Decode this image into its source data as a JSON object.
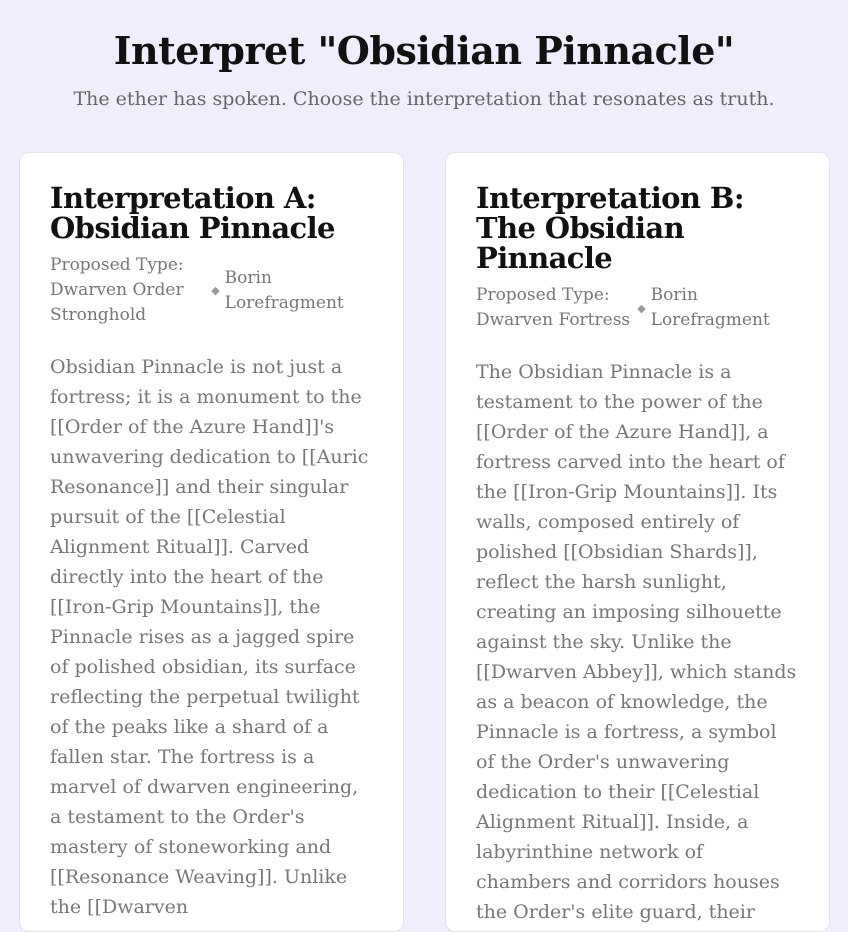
{
  "header": {
    "title": "Interpret \"Obsidian Pinnacle\"",
    "subtitle": "The ether has spoken. Choose the interpretation that resonates as truth."
  },
  "cards": [
    {
      "title": "Interpretation A: Obsidian Pinnacle",
      "proposed_type": "Proposed Type: Dwarven Order Stronghold",
      "author_icon": "feather-icon",
      "author": "Borin Lorefragment",
      "body": "Obsidian Pinnacle is not just a fortress; it is a monument to the [[Order of the Azure Hand]]'s unwavering dedication to [[Auric Resonance]] and their singular pursuit of the [[Celestial Alignment Ritual]]. Carved directly into the heart of the [[Iron-Grip Mountains]], the Pinnacle rises as a jagged spire of polished obsidian, its surface reflecting the perpetual twilight of the peaks like a shard of a fallen star. The fortress is a marvel of dwarven engineering, a testament to the Order's mastery of stoneworking and [[Resonance Weaving]]. Unlike the [[Dwarven"
    },
    {
      "title": "Interpretation B: The Obsidian Pinnacle",
      "proposed_type": "Proposed Type: Dwarven Fortress",
      "author_icon": "feather-icon",
      "author": "Borin Lorefragment",
      "body": "The Obsidian Pinnacle is a testament to the power of the [[Order of the Azure Hand]], a fortress carved into the heart of the [[Iron-Grip Mountains]]. Its walls, composed entirely of polished [[Obsidian Shards]], reflect the harsh sunlight, creating an imposing silhouette against the sky. Unlike the [[Dwarven Abbey]], which stands as a beacon of knowledge, the Pinnacle is a fortress, a symbol of the Order's unwavering dedication to their [[Celestial Alignment Ritual]]. Inside, a labyrinthine network of chambers and corridors houses the Order's elite guard, their"
    }
  ]
}
